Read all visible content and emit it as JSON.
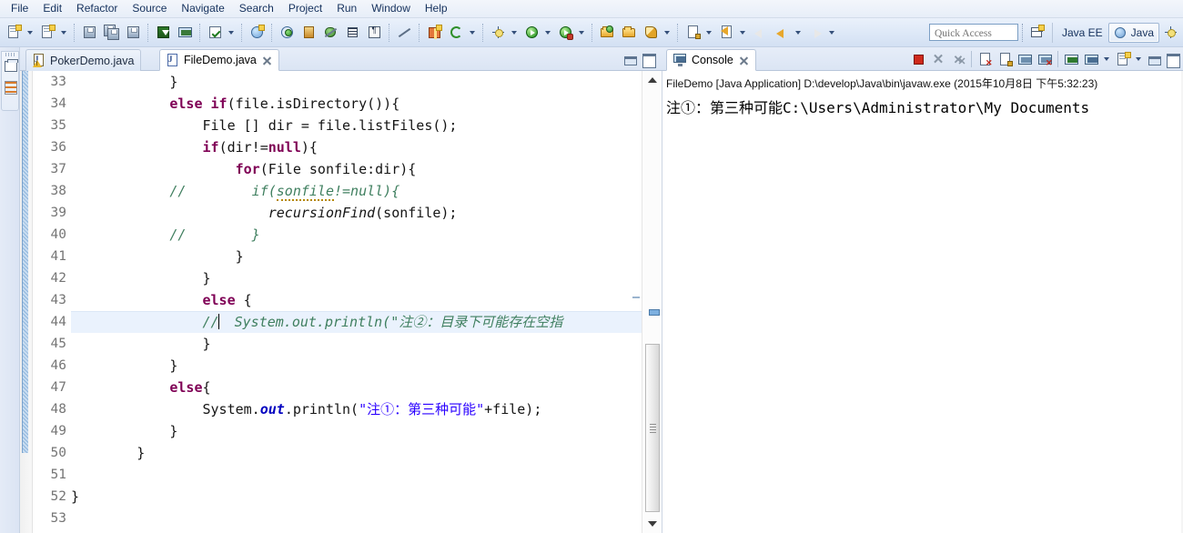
{
  "menubar": {
    "items": [
      {
        "label": "File"
      },
      {
        "label": "Edit"
      },
      {
        "label": "Refactor"
      },
      {
        "label": "Source"
      },
      {
        "label": "Navigate"
      },
      {
        "label": "Search"
      },
      {
        "label": "Project"
      },
      {
        "label": "Run"
      },
      {
        "label": "Window"
      },
      {
        "label": "Help"
      }
    ]
  },
  "toolbar": {
    "icons": [
      {
        "name": "new-wizard-icon"
      },
      {
        "name": "new-wizard-dropdown-icon"
      },
      {
        "name": "new-java-class-icon"
      },
      {
        "name": "new-java-class-dropdown-icon"
      },
      {
        "name": "save-icon"
      },
      {
        "name": "save-all-icon"
      },
      {
        "name": "print-icon"
      },
      {
        "name": "import-icon"
      },
      {
        "name": "build-all-icon"
      },
      {
        "name": "toggle-mark-occurrences-icon"
      },
      {
        "name": "mark-occurrences-dropdown-icon"
      },
      {
        "name": "new-java-project-icon"
      },
      {
        "name": "search-icon"
      },
      {
        "name": "external-tools-icon"
      },
      {
        "name": "skip-breakpoints-icon"
      },
      {
        "name": "toggle-block-selection-icon"
      },
      {
        "name": "show-whitespace-icon"
      },
      {
        "name": "toggle-breakpoint-icon"
      },
      {
        "name": "new-plugin-icon"
      },
      {
        "name": "refresh-icon"
      },
      {
        "name": "debug-icon"
      },
      {
        "name": "debug-dropdown-icon"
      },
      {
        "name": "run-icon"
      },
      {
        "name": "run-dropdown-icon"
      },
      {
        "name": "run-external-icon"
      },
      {
        "name": "run-external-dropdown-icon"
      },
      {
        "name": "open-type-icon"
      },
      {
        "name": "open-task-icon"
      },
      {
        "name": "coverage-icon"
      },
      {
        "name": "coverage-dropdown-icon"
      },
      {
        "name": "next-annotation-icon"
      },
      {
        "name": "next-annotation-dropdown-icon"
      },
      {
        "name": "previous-annotation-icon"
      },
      {
        "name": "previous-annotation-dropdown-icon"
      },
      {
        "name": "back-icon"
      },
      {
        "name": "back-dropdown-icon"
      },
      {
        "name": "forward-icon"
      },
      {
        "name": "forward-dropdown-icon"
      }
    ]
  },
  "quick_access": {
    "placeholder": "Quick Access"
  },
  "perspectives": {
    "open_perspective_icon": "open-perspective-icon",
    "items": [
      {
        "label": "Java EE",
        "active": false
      },
      {
        "label": "Java",
        "active": true
      }
    ],
    "extra_icon": "customize-perspective-icon"
  },
  "left_stack": {
    "items": [
      {
        "name": "restore-views-icon"
      },
      {
        "name": "outline-view-icon"
      }
    ]
  },
  "editor": {
    "tabs": [
      {
        "label": "PokerDemo.java",
        "active": false,
        "has_warning": true,
        "closable": false
      },
      {
        "label": "FileDemo.java",
        "active": true,
        "has_warning": false,
        "closable": true
      }
    ],
    "pane_buttons": [
      {
        "name": "minimize-editor-button",
        "label": ""
      },
      {
        "name": "maximize-editor-button",
        "label": ""
      }
    ],
    "first_line_number": 33,
    "current_line_number": 44,
    "zoom": "",
    "lines": [
      {
        "n": 33,
        "tokens": [
          {
            "t": "            }",
            "c": "plain"
          }
        ]
      },
      {
        "n": 34,
        "tokens": [
          {
            "t": "            ",
            "c": "plain"
          },
          {
            "t": "else if",
            "c": "kw"
          },
          {
            "t": "(file.isDirectory()){",
            "c": "plain"
          }
        ]
      },
      {
        "n": 35,
        "tokens": [
          {
            "t": "                File [] dir = file.listFiles();",
            "c": "plain"
          }
        ]
      },
      {
        "n": 36,
        "tokens": [
          {
            "t": "                ",
            "c": "plain"
          },
          {
            "t": "if",
            "c": "kw"
          },
          {
            "t": "(dir!=",
            "c": "plain"
          },
          {
            "t": "null",
            "c": "kw"
          },
          {
            "t": "){",
            "c": "plain"
          }
        ]
      },
      {
        "n": 37,
        "tokens": [
          {
            "t": "                    ",
            "c": "plain"
          },
          {
            "t": "for",
            "c": "kw"
          },
          {
            "t": "(File sonfile:dir){",
            "c": "plain"
          }
        ]
      },
      {
        "n": 38,
        "tokens": [
          {
            "t": "            ",
            "c": "plain"
          },
          {
            "t": "//        if(sonfile!=null){",
            "c": "cmt"
          }
        ]
      },
      {
        "n": 39,
        "tokens": [
          {
            "t": "                        ",
            "c": "plain"
          },
          {
            "t": "recursionFind",
            "c": "mth"
          },
          {
            "t": "(sonfile);",
            "c": "plain"
          }
        ]
      },
      {
        "n": 40,
        "tokens": [
          {
            "t": "            ",
            "c": "plain"
          },
          {
            "t": "//        }",
            "c": "cmt"
          }
        ]
      },
      {
        "n": 41,
        "tokens": [
          {
            "t": "                    }",
            "c": "plain"
          }
        ]
      },
      {
        "n": 42,
        "tokens": [
          {
            "t": "                }",
            "c": "plain"
          }
        ]
      },
      {
        "n": 43,
        "tokens": [
          {
            "t": "                ",
            "c": "plain"
          },
          {
            "t": "else",
            "c": "kw"
          },
          {
            "t": " {",
            "c": "plain"
          }
        ]
      },
      {
        "n": 44,
        "tokens": [
          {
            "t": "                ",
            "c": "plain"
          },
          {
            "t": "//",
            "c": "cmt"
          },
          {
            "t": "CARET",
            "c": "caret"
          },
          {
            "t": "  System.out.println(\"注②：目录下可能存在空指",
            "c": "cmt"
          }
        ]
      },
      {
        "n": 45,
        "tokens": [
          {
            "t": "                }",
            "c": "plain"
          }
        ]
      },
      {
        "n": 46,
        "tokens": [
          {
            "t": "            }",
            "c": "plain"
          }
        ]
      },
      {
        "n": 47,
        "tokens": [
          {
            "t": "            ",
            "c": "plain"
          },
          {
            "t": "else",
            "c": "kw"
          },
          {
            "t": "{",
            "c": "plain"
          }
        ]
      },
      {
        "n": 48,
        "tokens": [
          {
            "t": "                System.",
            "c": "plain"
          },
          {
            "t": "out",
            "c": "fld"
          },
          {
            "t": ".println(",
            "c": "plain"
          },
          {
            "t": "\"注①：第三种可能\"",
            "c": "str"
          },
          {
            "t": "+file);",
            "c": "plain"
          }
        ]
      },
      {
        "n": 49,
        "tokens": [
          {
            "t": "            }",
            "c": "plain"
          }
        ]
      },
      {
        "n": 50,
        "tokens": [
          {
            "t": "        }",
            "c": "plain"
          }
        ]
      },
      {
        "n": 51,
        "tokens": [
          {
            "t": "",
            "c": "plain"
          }
        ]
      },
      {
        "n": 52,
        "tokens": [
          {
            "t": "}",
            "c": "plain"
          }
        ]
      },
      {
        "n": 53,
        "tokens": [
          {
            "t": "",
            "c": "plain"
          }
        ]
      }
    ],
    "scrollbar": {
      "name": "editor-vertical-scrollbar",
      "overview_marker": "todo-marker"
    }
  },
  "console": {
    "tab_label": "Console",
    "tab_icon": "console-icon",
    "closable": true,
    "tools": [
      {
        "name": "terminate-button"
      },
      {
        "name": "remove-launch-button"
      },
      {
        "name": "remove-all-terminated-button"
      },
      {
        "name": "clear-console-button"
      },
      {
        "name": "scroll-lock-button"
      },
      {
        "name": "show-console-when-output-changes-button"
      },
      {
        "name": "pin-console-button"
      },
      {
        "name": "display-selected-console-button"
      },
      {
        "name": "display-selected-console-dropdown"
      },
      {
        "name": "open-console-button"
      },
      {
        "name": "open-console-dropdown"
      },
      {
        "name": "minimize-console-button"
      },
      {
        "name": "maximize-console-button"
      }
    ],
    "header": "FileDemo [Java Application] D:\\develop\\Java\\bin\\javaw.exe (2015年10月8日 下午5:32:23)",
    "output": "注①：第三种可能C:\\Users\\Administrator\\My Documents"
  },
  "colors": {
    "keyword": "#7f0055",
    "comment": "#3f7f5f",
    "string": "#2a00ff",
    "static_field": "#0000c0",
    "current_line": "#eaf2fd",
    "chrome": "#dbe5f4"
  }
}
